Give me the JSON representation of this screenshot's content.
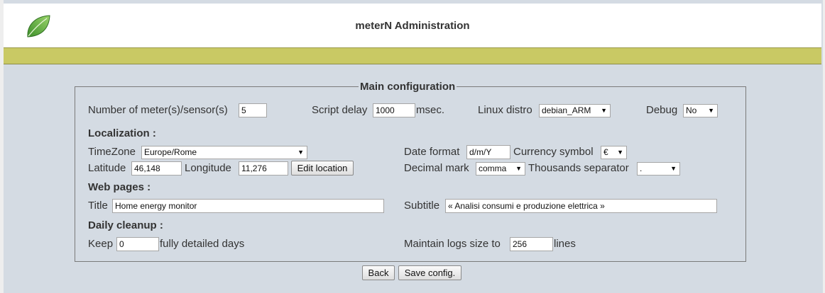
{
  "header": {
    "title": "meterN Administration",
    "logo_icon": "leaf-icon"
  },
  "config": {
    "legend": "Main configuration",
    "meters_label": "Number of meter(s)/sensor(s)",
    "meters_value": "5",
    "script_delay_label": "Script delay",
    "script_delay_value": "1000",
    "script_delay_unit": "msec.",
    "linux_distro_label": "Linux distro",
    "linux_distro_value": "debian_ARM",
    "debug_label": "Debug",
    "debug_value": "No",
    "localization_heading": "Localization :",
    "timezone_label": "TimeZone",
    "timezone_value": "Europe/Rome",
    "date_format_label": "Date format",
    "date_format_value": "d/m/Y",
    "currency_label": "Currency symbol",
    "currency_value": "€",
    "latitude_label": "Latitude",
    "latitude_value": "46,148",
    "longitude_label": "Longitude",
    "longitude_value": "11,276",
    "edit_location_label": "Edit location",
    "decimal_label": "Decimal mark",
    "decimal_value": "comma",
    "thousands_label": "Thousands separator",
    "thousands_value": ".",
    "webpages_heading": "Web pages :",
    "title_label": "Title",
    "title_value": "Home energy monitor",
    "subtitle_label": "Subtitle",
    "subtitle_value": "« Analisi consumi e produzione elettrica »",
    "cleanup_heading": "Daily cleanup :",
    "keep_label": "Keep",
    "keep_value": "0",
    "keep_suffix": "fully detailed days",
    "logs_label": "Maintain logs size to",
    "logs_value": "256",
    "logs_suffix": "lines"
  },
  "buttons": {
    "back_label": "Back",
    "save_label": "Save config."
  }
}
